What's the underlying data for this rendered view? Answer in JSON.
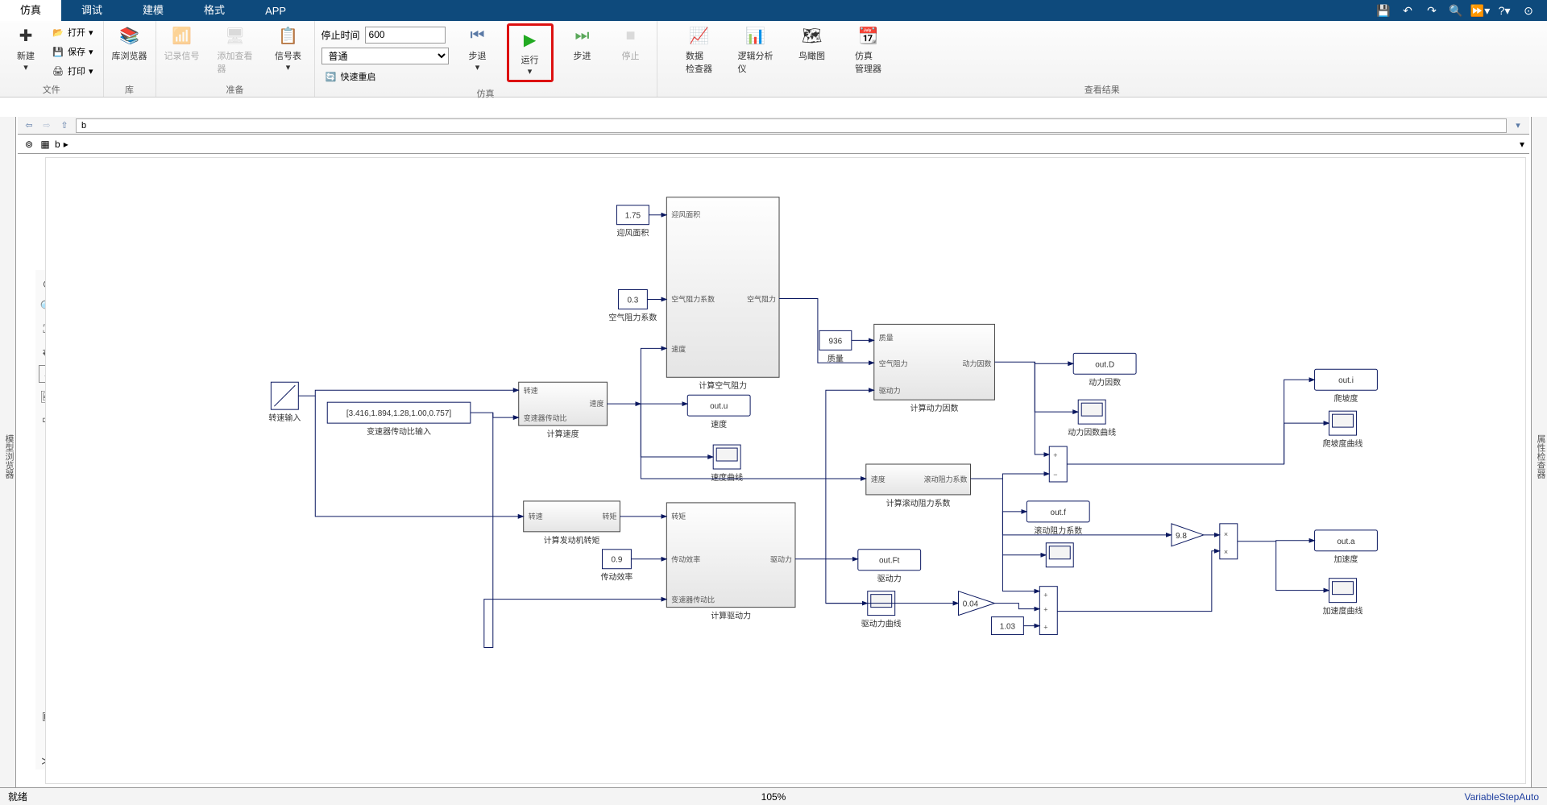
{
  "tabs": {
    "simulation": "仿真",
    "debug": "调试",
    "modeling": "建模",
    "format": "格式",
    "app": "APP"
  },
  "ribbon": {
    "file_group": "文件",
    "new": "新建",
    "open": "打开",
    "save": "保存",
    "print": "打印",
    "library_group": "库",
    "library_browser": "库浏览器",
    "prepare_group": "准备",
    "log_signal": "记录信号",
    "add_viewer": "添加查看器",
    "signal_table": "信号表",
    "stop_time_label": "停止时间",
    "stop_time_value": "600",
    "sim_mode": "普通",
    "fast_restart": "快速重启",
    "sim_group": "仿真",
    "step_back": "步退",
    "run": "运行",
    "step_forward": "步进",
    "stop": "停止",
    "results_group": "查看结果",
    "data_inspector": "数据\n检查器",
    "logic_analyzer": "逻辑分析仪",
    "birds_eye": "鸟瞰图",
    "sim_manager": "仿真\n管理器"
  },
  "nav": {
    "path": "b"
  },
  "breadcrumb": {
    "model": "b"
  },
  "side_left": "模型浏览器",
  "side_right": "属性检查器",
  "status": {
    "ready": "就绪",
    "zoom": "105%",
    "solver": "VariableStepAuto"
  },
  "blocks": {
    "ramp": "转速输入",
    "gear_ratios_val": "[3.416,1.894,1.28,1.00,0.757]",
    "gear_ratios": "变速器传动比输入",
    "calc_speed": "计算速度",
    "calc_speed_in1": "转速",
    "calc_speed_in2": "变速器传动比",
    "calc_speed_out": "速度",
    "windage_area_val": "1.75",
    "windage_area": "迎风面积",
    "drag_coeff_val": "0.3",
    "drag_coeff": "空气阻力系数",
    "calc_air_res": "计算空气阻力",
    "air_in1": "迎风面积",
    "air_in2": "空气阻力系数",
    "air_in3": "速度",
    "air_out": "空气阻力",
    "out_u": "out.u",
    "out_u_lbl": "速度",
    "speed_curve": "速度曲线",
    "mass_val": "936",
    "mass": "质量",
    "calc_dyn_factor": "计算动力因数",
    "dyn_in1": "质量",
    "dyn_in2": "空气阻力",
    "dyn_in3": "驱动力",
    "dyn_out": "动力因数",
    "out_d": "out.D",
    "out_d_lbl": "动力因数",
    "dyn_curve": "动力因数曲线",
    "calc_roll": "计算滚动阻力系数",
    "roll_in": "速度",
    "roll_out": "滚动阻力系数",
    "out_f": "out.f",
    "out_f_lbl": "滚动阻力系数",
    "roll_scope": "",
    "calc_engine_torque": "计算发动机转矩",
    "torque_in": "转速",
    "torque_out": "转矩",
    "trans_eff_val": "0.9",
    "trans_eff": "传动效率",
    "calc_drive": "计算驱动力",
    "drive_in1": "转矩",
    "drive_in2": "传动效率",
    "drive_in3": "变速器传动比",
    "drive_out": "驱动力",
    "out_ft": "out.Ft",
    "out_ft_lbl": "驱动力",
    "drive_curve": "驱动力曲线",
    "gain_004": "0.04",
    "const_103": "1.03",
    "out_i": "out.i",
    "out_i_lbl": "爬坡度",
    "climb_curve": "爬坡度曲线",
    "gain_98": "9.8",
    "out_a": "out.a",
    "out_a_lbl": "加速度",
    "accel_curve": "加速度曲线"
  }
}
